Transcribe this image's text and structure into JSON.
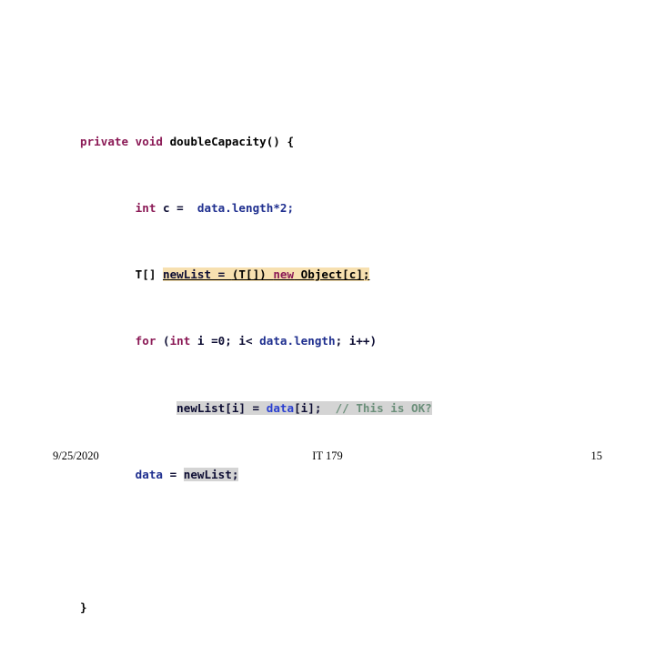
{
  "slide": {
    "title": "",
    "background_color": "#FFFFFF"
  },
  "code": {
    "language": "Java",
    "highlight_colors": {
      "cast_line_background": "#F7E0B0",
      "copy_line_background": "#D4D4D4",
      "keyword": "#8B1A56",
      "identifier_blue": "#1F2F8F",
      "comment": "#6B8F7A"
    },
    "lines": [
      {
        "id": "line-1",
        "text": "private void doubleCapacity() {",
        "tokens": [
          {
            "t": "private void ",
            "c": "kw"
          },
          {
            "t": "doubleCapacity() {",
            "c": "blk"
          }
        ]
      },
      {
        "id": "line-2",
        "text": "        int c =  data.length*2;",
        "tokens": [
          {
            "t": "        ",
            "c": "blk"
          },
          {
            "t": "int",
            "c": "kw"
          },
          {
            "t": " c =  ",
            "c": "plain"
          },
          {
            "t": "data.length",
            "c": "blue"
          },
          {
            "t": "*2;",
            "c": "blue"
          }
        ]
      },
      {
        "id": "line-3",
        "text": "        T[] newList = (T[]) new Object[c];",
        "tokens": [
          {
            "t": "        T[] ",
            "c": "blk"
          },
          {
            "t": "newList = ",
            "c": "plain"
          },
          {
            "t": "(T[]) ",
            "c": "blk"
          },
          {
            "t": "new",
            "c": "kw"
          },
          {
            "t": " Object[c];",
            "c": "blk"
          }
        ]
      },
      {
        "id": "line-4",
        "text": "        for (int i =0; i< data.length; i++)",
        "tokens": [
          {
            "t": "        ",
            "c": "blk"
          },
          {
            "t": "for",
            "c": "kw"
          },
          {
            "t": " (",
            "c": "plain"
          },
          {
            "t": "int",
            "c": "kw"
          },
          {
            "t": " i =0; i< ",
            "c": "plain"
          },
          {
            "t": "data.length",
            "c": "blue"
          },
          {
            "t": "; i++)",
            "c": "plain"
          }
        ]
      },
      {
        "id": "line-5",
        "text": "              newList[i] = data[i];  // This is OK?",
        "tokens": [
          {
            "t": "              ",
            "c": "blk"
          },
          {
            "t": "newList[i] = ",
            "c": "plain"
          },
          {
            "t": "data",
            "c": "blue2"
          },
          {
            "t": "[i];",
            "c": "plain"
          },
          {
            "t": "  // This is OK?",
            "c": "cmt"
          }
        ]
      },
      {
        "id": "line-6",
        "text": "        data = newList;",
        "tokens": [
          {
            "t": "        ",
            "c": "blk"
          },
          {
            "t": "data",
            "c": "blue"
          },
          {
            "t": " = ",
            "c": "plain"
          },
          {
            "t": "newList;",
            "c": "plain"
          }
        ]
      },
      {
        "id": "line-7",
        "text": "",
        "tokens": []
      },
      {
        "id": "line-8",
        "text": "}",
        "tokens": [
          {
            "t": "}",
            "c": "blk"
          }
        ]
      }
    ],
    "segments": {
      "l1_a": "private void ",
      "l1_b": "doubleCapacity() {",
      "l2_indent": "        ",
      "l2_int": "int",
      "l2_mid": " c =  ",
      "l2_expr": "data.length*2;",
      "l3_indent": "        T[] ",
      "l3_assign": "newList = ",
      "l3_cast": "(T[]) ",
      "l3_new": "new",
      "l3_obj": " Object[c];",
      "l4_indent": "        ",
      "l4_for": "for",
      "l4_open": " (",
      "l4_int": "int",
      "l4_mid": " i =0; i< ",
      "l4_len": "data.length",
      "l4_end": "; i++)",
      "l5_indent": "              ",
      "l5_lhs": "newList[i] = ",
      "l5_data": "data",
      "l5_idx": "[i];",
      "l5_comment": "  // This is OK?",
      "l6_indent": "        ",
      "l6_data": "data",
      "l6_eq": " = ",
      "l6_newlist": "newList;",
      "l8_brace": "}"
    }
  },
  "footer": {
    "date": "9/25/2020",
    "course": "IT 179",
    "page_number": "15"
  }
}
